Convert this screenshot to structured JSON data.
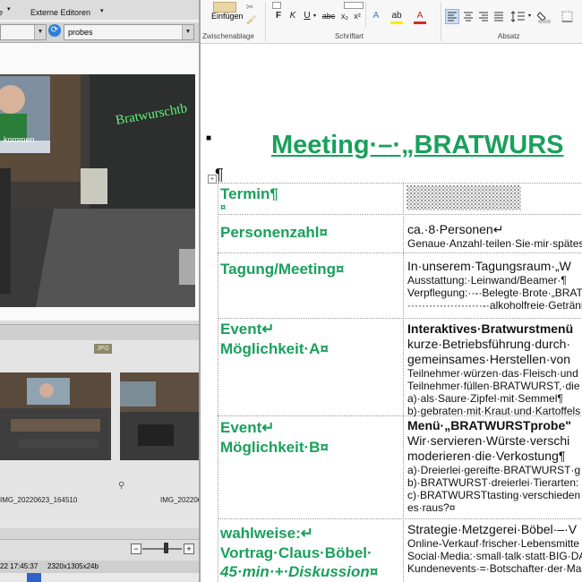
{
  "viewer": {
    "menu": {
      "item1": "Externe Editoren"
    },
    "path_value": "probes",
    "badge": "JPG",
    "photo_caption": "kommen",
    "thumbs": [
      {
        "name": "IMG_20220623_164510"
      },
      {
        "name": "IMG_2022062"
      }
    ],
    "status": {
      "datetime": "22 17:45:37",
      "dimensions": "2320x1305x24b"
    }
  },
  "ribbon": {
    "paste_label": "Einfügen",
    "groups": {
      "clipboard": "Zwischenablage",
      "font": "Schriftart",
      "paragraph": "Absatz"
    },
    "font_buttons": {
      "bold": "F",
      "italic": "K",
      "underline": "U",
      "strike": "abc",
      "sub": "x₂",
      "sup": "x²"
    }
  },
  "doc": {
    "title": "Meeting·–·„BRATWURS",
    "rows": [
      {
        "label": "Termin¶",
        "label2": "¤",
        "lines": []
      },
      {
        "label": "Personenzahl¤",
        "lines": [
          "ca.·8·Personen↵",
          "Genaue·Anzahl·teilen·Sie·mir·spätes"
        ]
      },
      {
        "label": "Tagung/Meeting¤",
        "lines": [
          "In·unserem·Tagungsraum·„W",
          "Ausstattung:·Leinwand/Beamer·¶",
          "Verpflegung:··-·Belegte·Brote·„BRAT",
          "·····················-·alkoholfreie·Getränke"
        ]
      },
      {
        "label": "Event↵",
        "label2": "Möglichkeit·A¤",
        "lines": [
          "Interaktives·Bratwurstmenü",
          "kurze·Betriebsführung·durch·",
          "gemeinsames·Herstellen·von",
          "Teilnehmer·würzen·das·Fleisch·und",
          "Teilnehmer·füllen·BRATWURST,·die",
          "a)·als·Saure·Zipfel·mit·Semmel¶",
          "b)·gebraten·mit·Kraut·und·Kartoffels"
        ]
      },
      {
        "label": "Event↵",
        "label2": "Möglichkeit·B¤",
        "lines": [
          "Menü·„BRATWURSTprobe\"",
          "Wir·servieren·Würste·verschi",
          "moderieren·die·Verkostung¶",
          "a)·Dreierlei·gereifte·BRATWURST·g",
          "b)·BRATWURST·dreierlei·Tierarten:",
          "c)·BRATWURSTtasting·verschieden",
          "es·raus?¤"
        ]
      },
      {
        "label": "wahlweise:↵",
        "label2": "Vortrag·Claus·Böbel·",
        "label3": "45·min·+·Diskussion¤",
        "lines": [
          "Strategie·Metzgerei·Böbel·–·V",
          "Online-Verkauf·frischer·Lebensmitte",
          "Social·Media:·small·talk·statt·BIG·DA",
          "Kundenevents·=·Botschafter·der·Ma"
        ]
      }
    ]
  }
}
